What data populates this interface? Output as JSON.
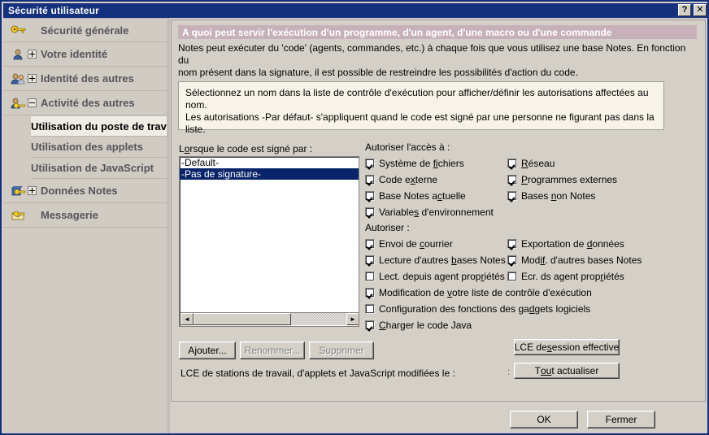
{
  "window": {
    "title": "Sécurité utilisateur",
    "help_button": "?",
    "close_button": "✕"
  },
  "sidebar": {
    "items": [
      {
        "label": "Sécurité générale",
        "icon": "key-icon",
        "expander": null,
        "selected": false
      },
      {
        "label": "Votre identité",
        "icon": "person-key-icon",
        "expander": "plus",
        "selected": false
      },
      {
        "label": "Identité des autres",
        "icon": "people-key-icon",
        "expander": "plus",
        "selected": false
      },
      {
        "label": "Activité des autres",
        "icon": "people-activity-icon",
        "expander": "minus",
        "selected": false
      }
    ],
    "sub_items": [
      {
        "label": "Utilisation du poste de travail",
        "selected": true
      },
      {
        "label": "Utilisation des applets",
        "selected": false
      },
      {
        "label": "Utilisation de JavaScript",
        "selected": false
      }
    ],
    "items_after": [
      {
        "label": "Données Notes",
        "icon": "book-key-icon",
        "expander": "plus",
        "selected": false
      },
      {
        "label": "Messagerie",
        "icon": "mail-key-icon",
        "expander": null,
        "selected": false
      }
    ]
  },
  "main": {
    "banner": "A quoi peut servir l'exécution d'un programme, d'un agent, d'une macro ou d'une commande",
    "intro_line1": "Notes peut exécuter du 'code' (agents, commandes, etc.) à chaque fois que vous utilisez une base Notes. En fonction du",
    "intro_line2": "nom présent dans la signature, il est possible de restreindre les possibilités d'action du code.",
    "infobox_line1": "Sélectionnez un nom dans la liste de contrôle d'exécution pour afficher/définir les autorisations affectées au nom.",
    "infobox_line2": "Les autorisations -Par défaut- s'appliquent quand le code est signé par une personne ne figurant pas dans la liste."
  },
  "list": {
    "label_pre": "L",
    "label_accel": "o",
    "label_post": "rsque le code est signé par :",
    "items": [
      {
        "text": "-Default-",
        "selected": false
      },
      {
        "text": "-Pas de signature-",
        "selected": true
      }
    ],
    "scroll_left_arrow": "◄",
    "scroll_right_arrow": "►"
  },
  "permissions": {
    "section_access": "Autoriser l'accès à :",
    "section_allow": "Autoriser :",
    "access_rows": [
      {
        "left": {
          "label_pre": "Système de ",
          "accel": "fi",
          "label_post": "chiers",
          "checked": true
        },
        "right": {
          "label_pre": "",
          "accel": "R",
          "label_post": "éseau",
          "checked": true
        }
      },
      {
        "left": {
          "label_pre": "Code e",
          "accel": "x",
          "label_post": "terne",
          "checked": true
        },
        "right": {
          "label_pre": "",
          "accel": "P",
          "label_post": "rogrammes externes",
          "checked": true
        }
      },
      {
        "left": {
          "label_pre": "Base Notes a",
          "accel": "c",
          "label_post": "tuelle",
          "checked": true
        },
        "right": {
          "label_pre": "Bases ",
          "accel": "n",
          "label_post": "on Notes",
          "checked": true
        }
      },
      {
        "left": {
          "label_pre": "Variable",
          "accel": "s",
          "label_post": " d'environnement",
          "checked": true
        },
        "right": null
      }
    ],
    "allow_rows": [
      {
        "left": {
          "label_pre": "Envoi de ",
          "accel": "c",
          "label_post": "ourrier",
          "checked": true
        },
        "right": {
          "label_pre": "Exportation de ",
          "accel": "d",
          "label_post": "onnées",
          "checked": true
        }
      },
      {
        "left": {
          "label_pre": "Lecture d'autres ",
          "accel": "b",
          "label_post": "ases Notes",
          "checked": true
        },
        "right": {
          "label_pre": "Mod",
          "accel": "if",
          "label_post": ". d'autres bases Notes",
          "checked": true
        }
      },
      {
        "left": {
          "label_pre": "Lect. depuis agent prop",
          "accel": "r",
          "label_post": "iétés",
          "checked": false
        },
        "right": {
          "label_pre": "Ecr. ds agent prop",
          "accel": "r",
          "label_post": "iétés",
          "checked": false
        }
      },
      {
        "left": {
          "label_pre": "Modification de ",
          "accel": "v",
          "label_post": "otre liste de contrôle d'exécution",
          "checked": true
        },
        "right": null
      },
      {
        "left": {
          "label_pre": "Configuration des fonctions des ga",
          "accel": "d",
          "label_post": "gets logiciels",
          "checked": false
        },
        "right": null
      },
      {
        "left": {
          "label_pre": "",
          "accel": "C",
          "label_post": "harger le code Java",
          "checked": true
        },
        "right": null
      }
    ]
  },
  "actions": {
    "add_pre": "A",
    "add_accel": "j",
    "add_post": "outer...",
    "rename_pre": "",
    "rename_accel": "R",
    "rename_post": "enommer...",
    "delete_pre": "Supprim",
    "delete_accel": "e",
    "delete_post": "r",
    "effective_pre": "LCE de ",
    "effective_accel": "s",
    "effective_post": "ession effective",
    "refresh_pre": "T",
    "refresh_accel": "ou",
    "refresh_post": "t actualiser",
    "date_line": "LCE de stations de travail, d'applets et JavaScript modifiées le :",
    "date_value": ":",
    "ok": "OK",
    "close": "Fermer"
  },
  "colors": {
    "title_bar": "#16317d",
    "window_border": "#10307e",
    "banner_bg": "#c7b1b8",
    "infobox_bg": "#f7f3e8",
    "dialog_face": "#d4d0c8",
    "sidebar_bg": "#d0ccc4",
    "selection_blue": "#0a246a",
    "nav_text": "#57535a"
  }
}
